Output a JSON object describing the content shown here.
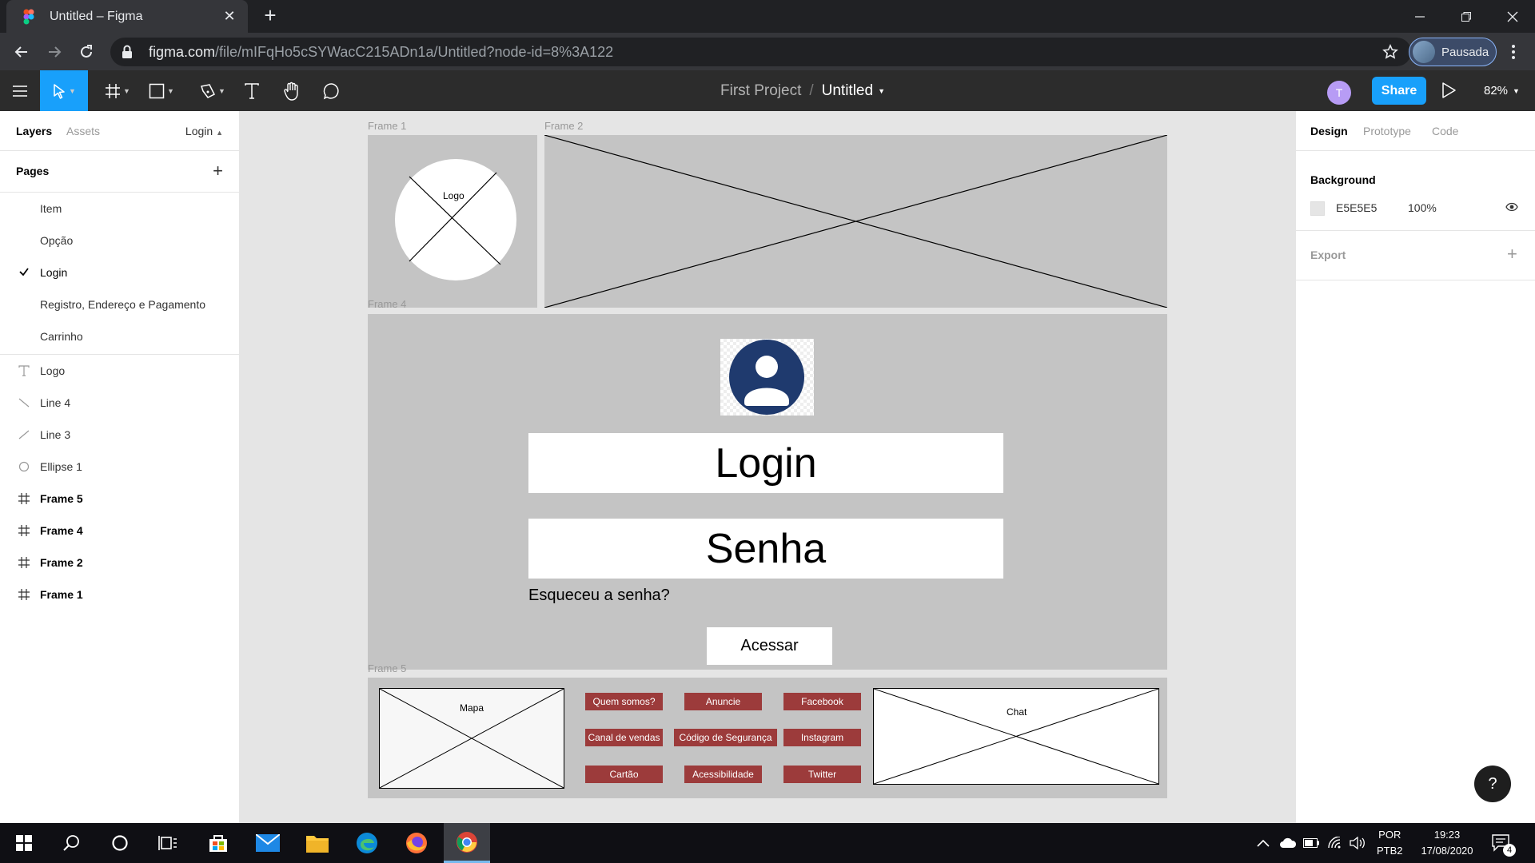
{
  "browser": {
    "tab_title": "Untitled – Figma",
    "tab_close": "✕",
    "new_tab": "+",
    "url_host": "figma.com",
    "url_path": "/file/mIFqHo5cSYWacC215ADn1a/Untitled?node-id=8%3A122",
    "profile_label": "Pausada"
  },
  "toolbar": {
    "project": "First Project",
    "separator": "/",
    "file": "Untitled",
    "avatar": "T",
    "share": "Share",
    "zoom": "82%"
  },
  "left_panel": {
    "tabs": [
      "Layers",
      "Assets"
    ],
    "current_page": "Login",
    "pages_header": "Pages",
    "pages": [
      {
        "label": "Item"
      },
      {
        "label": "Opção"
      },
      {
        "label": "Login",
        "current": true
      },
      {
        "label": "Registro, Endereço e Pagamento"
      },
      {
        "label": "Carrinho"
      }
    ],
    "layers": [
      {
        "label": "Logo",
        "icon": "text-icon"
      },
      {
        "label": "Line 4",
        "icon": "line-icon"
      },
      {
        "label": "Line 3",
        "icon": "line-icon"
      },
      {
        "label": "Ellipse 1",
        "icon": "ellipse-icon"
      },
      {
        "label": "Frame 5",
        "icon": "frame-icon"
      },
      {
        "label": "Frame 4",
        "icon": "frame-icon"
      },
      {
        "label": "Frame 2",
        "icon": "frame-icon"
      },
      {
        "label": "Frame 1",
        "icon": "frame-icon"
      }
    ]
  },
  "right_panel": {
    "tabs": [
      "Design",
      "Prototype",
      "Code"
    ],
    "background_label": "Background",
    "background_hex": "E5E5E5",
    "background_opacity": "100%",
    "export_label": "Export",
    "export_plus": "+",
    "help": "?"
  },
  "canvas": {
    "frame_labels": [
      "Frame 1",
      "Frame 2",
      "Frame 4",
      "Frame 5"
    ],
    "logo_label": "Logo",
    "login_field": "Login",
    "password_field": "Senha",
    "forgot_password": "Esqueceu a senha?",
    "access_button": "Acessar",
    "map_label": "Mapa",
    "chat_label": "Chat",
    "footer_buttons": [
      "Quem somos?",
      "Anuncie",
      "Facebook",
      "Canal de vendas",
      "Código de Segurança",
      "Instagram",
      "Cartão",
      "Acessibilidade",
      "Twitter"
    ]
  },
  "taskbar": {
    "lang_top": "POR",
    "lang_bottom": "PTB2",
    "time": "19:23",
    "date": "17/08/2020",
    "notification_count": "4"
  },
  "colors": {
    "accent": "#18a0fb",
    "frame_gray": "#c4c4c4",
    "footer_button": "#9c3b3b",
    "avatar_navy": "#1f3a6e"
  }
}
